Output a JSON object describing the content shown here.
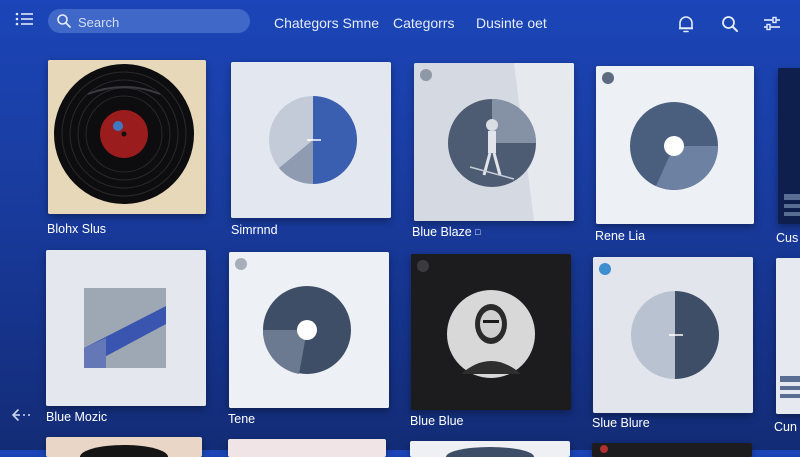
{
  "search": {
    "placeholder": "Search"
  },
  "nav": {
    "link_1": "Chategors Smne",
    "link_2": "Categorrs",
    "link_3": "Dusinte oet"
  },
  "icons": {
    "menu": "menu-icon",
    "search": "search-icon",
    "bell": "bell-icon",
    "header_search": "search-icon",
    "filters": "sliders-icon",
    "back": "back-arrow-icon"
  },
  "colors": {
    "background": "#1a3fa6",
    "search_bg": "#3f68c9",
    "accent_blue": "#3a5fb0",
    "disc_dark": "#4a5e7e"
  },
  "grid": {
    "row1": [
      {
        "label": "Blohx Slus"
      },
      {
        "label": "Simrnnd"
      },
      {
        "label": "Blue Blaze",
        "badge": "□"
      },
      {
        "label": "Rene Lia"
      },
      {
        "label": "Cus"
      }
    ],
    "row2": [
      {
        "label": "Blue Mozic"
      },
      {
        "label": "Tene"
      },
      {
        "label": "Blue Blue"
      },
      {
        "label": "Slue Blure"
      },
      {
        "label": "Cun"
      }
    ]
  }
}
